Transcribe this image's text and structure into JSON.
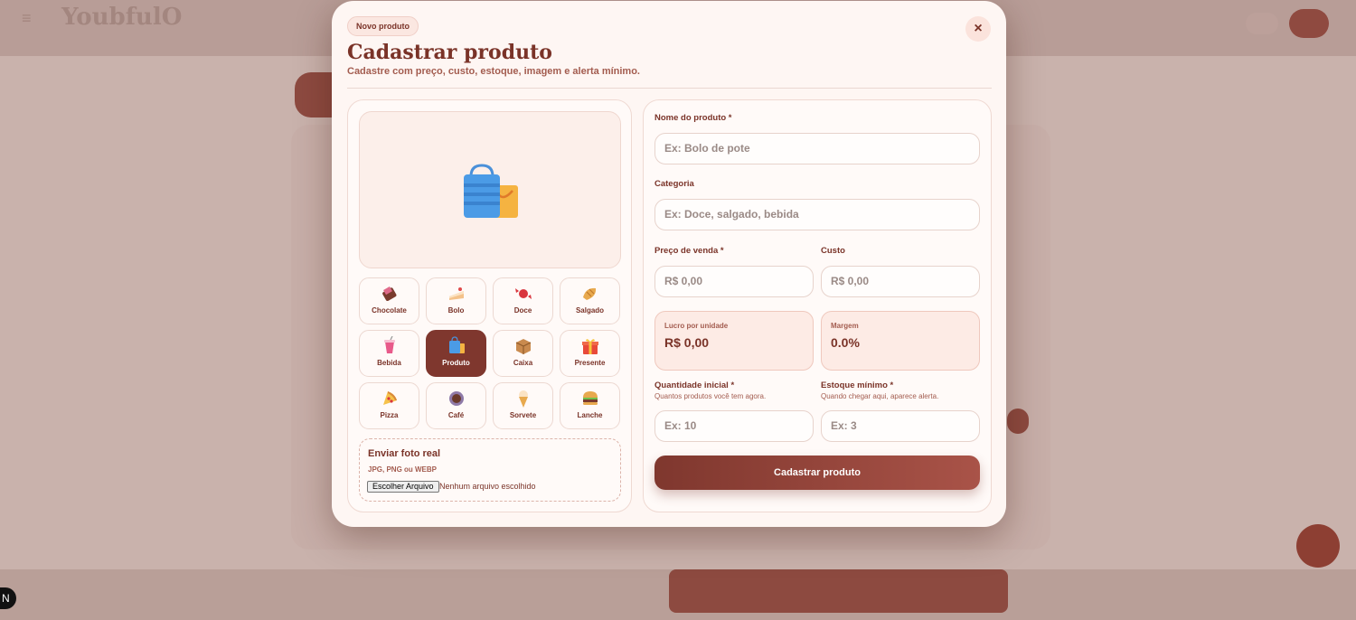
{
  "background": {
    "logo": "YoubfulO",
    "nav_badge": "N"
  },
  "modal": {
    "badge": "Novo produto",
    "close_icon": "×",
    "title": "Cadastrar produto",
    "subtitle": "Cadastre com preço, custo, estoque, imagem e alerta mínimo.",
    "preview_icon": "shopping-bags-icon",
    "categories": [
      {
        "label": "Chocolate",
        "icon": "chocolate-icon",
        "active": false
      },
      {
        "label": "Bolo",
        "icon": "cake-icon",
        "active": false
      },
      {
        "label": "Doce",
        "icon": "candy-icon",
        "active": false
      },
      {
        "label": "Salgado",
        "icon": "croissant-icon",
        "active": false
      },
      {
        "label": "Bebida",
        "icon": "drink-icon",
        "active": false
      },
      {
        "label": "Produto",
        "icon": "shopping-bags-icon",
        "active": true
      },
      {
        "label": "Caixa",
        "icon": "box-icon",
        "active": false
      },
      {
        "label": "Presente",
        "icon": "gift-icon",
        "active": false
      },
      {
        "label": "Pizza",
        "icon": "pizza-icon",
        "active": false
      },
      {
        "label": "Café",
        "icon": "coffee-icon",
        "active": false
      },
      {
        "label": "Sorvete",
        "icon": "ice-cream-icon",
        "active": false
      },
      {
        "label": "Lanche",
        "icon": "burger-icon",
        "active": false
      }
    ],
    "upload": {
      "title": "Enviar foto real",
      "formats": "JPG, PNG ou WEBP",
      "button": "Escolher Arquivo",
      "status": "Nenhum arquivo escolhido"
    },
    "form": {
      "name_label": "Nome do produto *",
      "name_placeholder": "Ex: Bolo de pote",
      "category_label": "Categoria",
      "category_placeholder": "Ex: Doce, salgado, bebida",
      "price_label": "Preço de venda *",
      "price_placeholder": "R$ 0,00",
      "cost_label": "Custo",
      "cost_placeholder": "R$ 0,00",
      "profit_label": "Lucro por unidade",
      "profit_value": "R$ 0,00",
      "margin_label": "Margem",
      "margin_value": "0.0%",
      "qty_label": "Quantidade inicial *",
      "qty_hint": "Quantos produtos você tem agora.",
      "qty_placeholder": "Ex: 10",
      "min_label": "Estoque mínimo *",
      "min_hint": "Quando chegar aqui, aparece alerta.",
      "min_placeholder": "Ex: 3",
      "submit": "Cadastrar produto"
    }
  },
  "colors": {
    "brand": "#7f372e",
    "accent": "#a95348",
    "surface": "#fef6f3"
  }
}
